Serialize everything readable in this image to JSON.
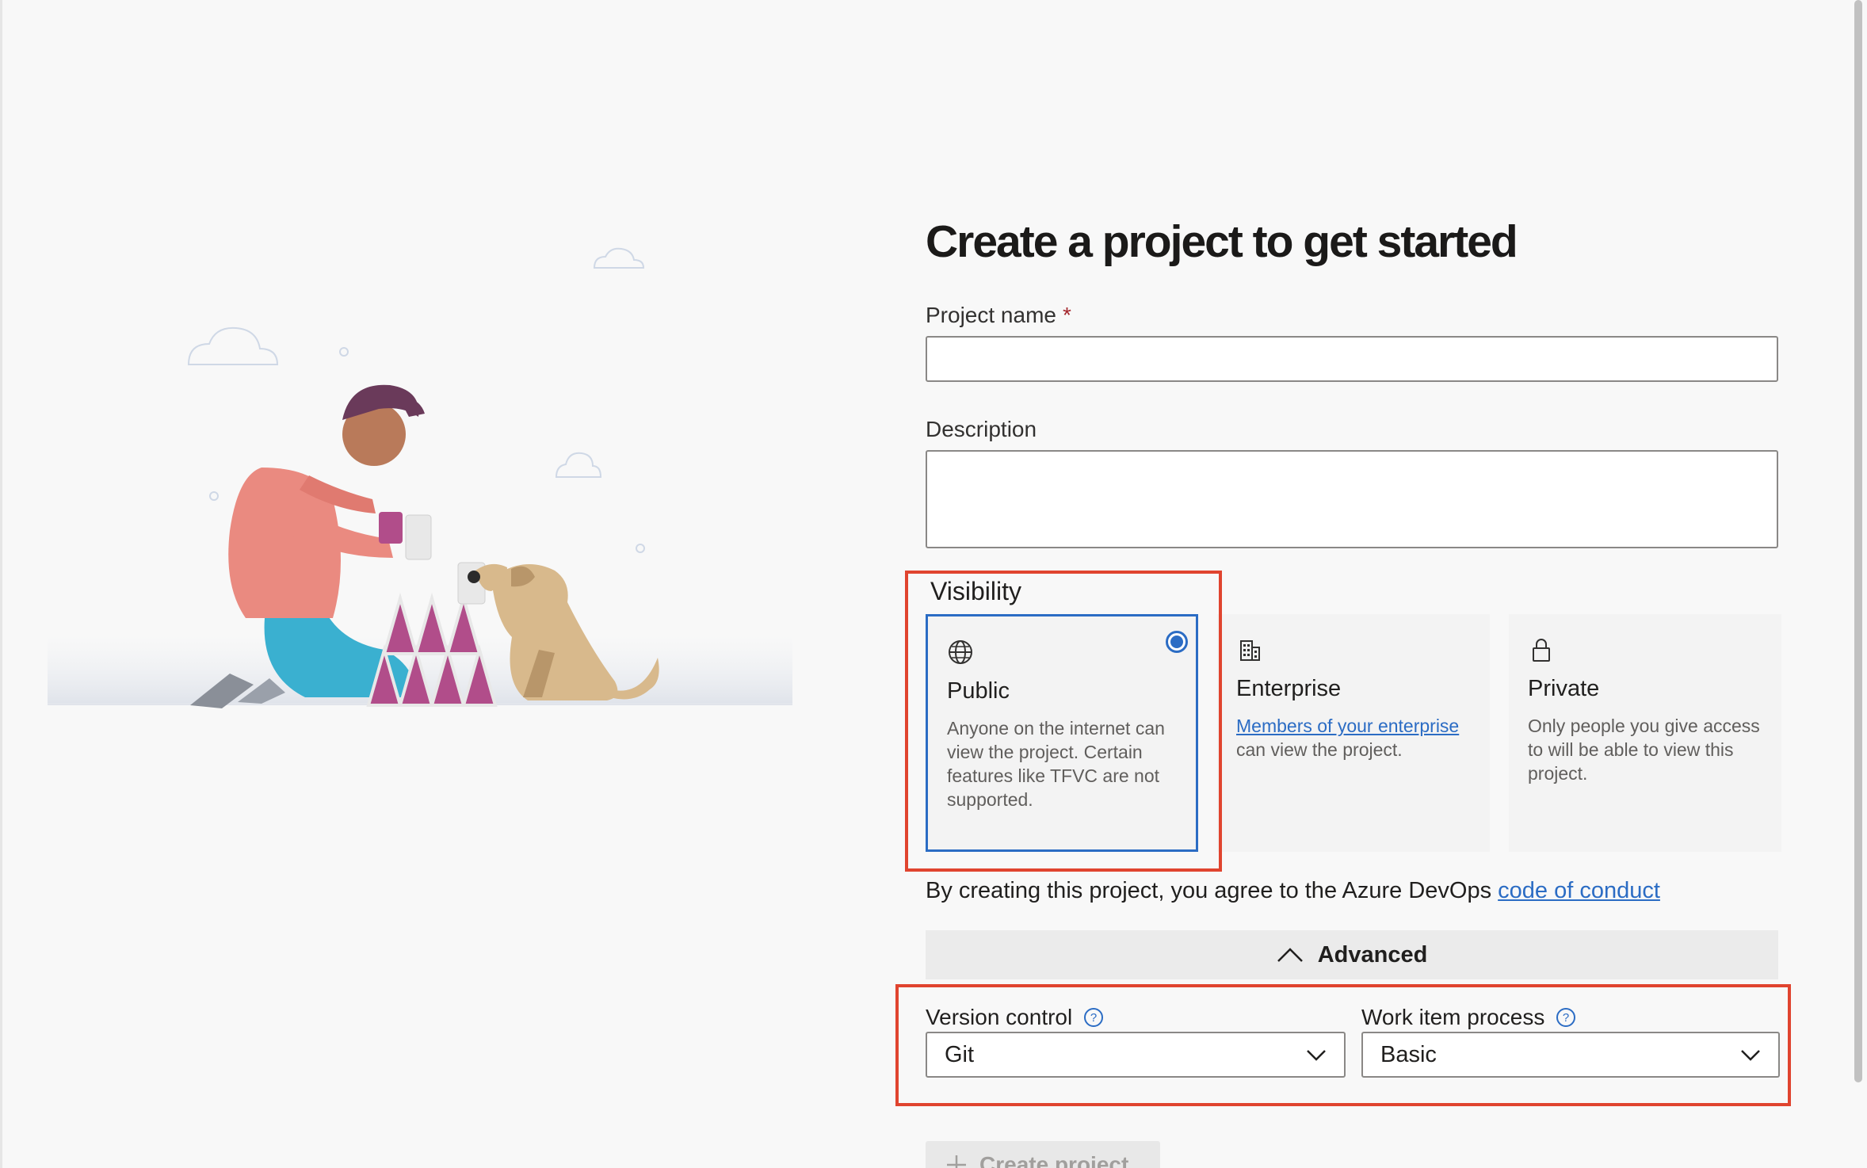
{
  "header": {
    "title": "Create a project to get started"
  },
  "project_name": {
    "label": "Project name",
    "required_marker": "*",
    "value": ""
  },
  "description": {
    "label": "Description",
    "value": ""
  },
  "visibility": {
    "label": "Visibility",
    "options": [
      {
        "title": "Public",
        "description": "Anyone on the internet can view the project. Certain features like TFVC are not supported.",
        "selected": true,
        "icon": "globe-icon"
      },
      {
        "title": "Enterprise",
        "link_text": "Members of your enterprise",
        "description_suffix": " can view the project.",
        "selected": false,
        "icon": "building-icon"
      },
      {
        "title": "Private",
        "description": "Only people you give access to will be able to view this project.",
        "selected": false,
        "icon": "lock-icon"
      }
    ]
  },
  "agreement": {
    "prefix": "By creating this project, you agree to the Azure DevOps ",
    "link_text": "code of conduct"
  },
  "advanced": {
    "label": "Advanced",
    "expanded": true
  },
  "version_control": {
    "label": "Version control",
    "value": "Git"
  },
  "work_item_process": {
    "label": "Work item process",
    "value": "Basic"
  },
  "create_button": {
    "label": "Create project"
  },
  "colors": {
    "accent": "#2b6cc4",
    "highlight": "#e0442f",
    "required": "#a4262c"
  }
}
